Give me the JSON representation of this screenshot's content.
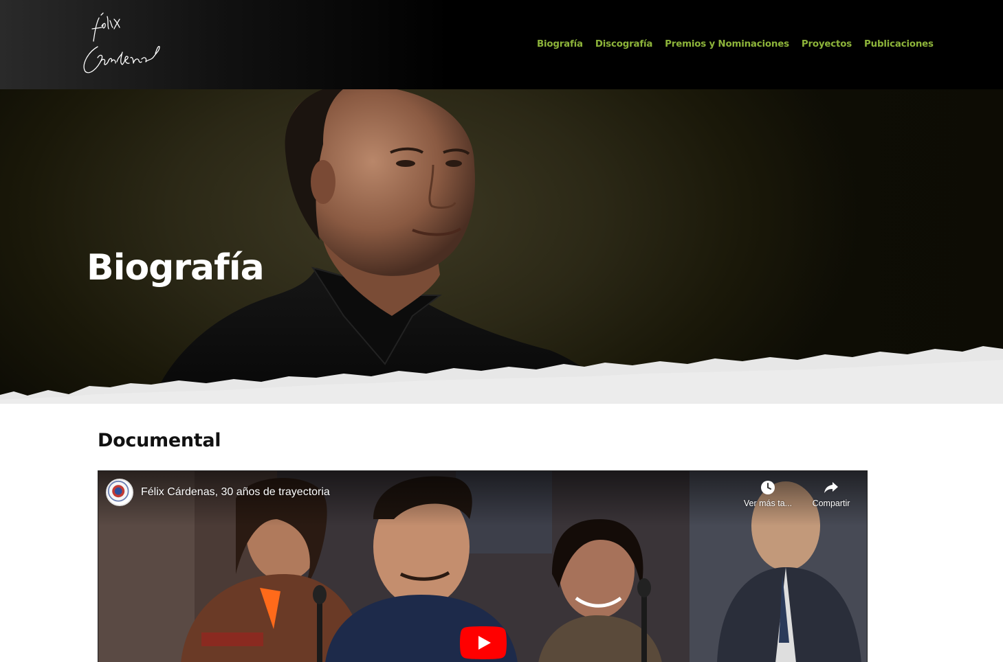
{
  "header": {
    "logo_text": "Félix Cárdenas",
    "nav": [
      {
        "label": "Biografía"
      },
      {
        "label": "Discografía"
      },
      {
        "label": "Premios y Nominaciones"
      },
      {
        "label": "Proyectos"
      },
      {
        "label": "Publicaciones"
      }
    ]
  },
  "hero": {
    "title": "Biografía"
  },
  "section": {
    "title": "Documental"
  },
  "video": {
    "title": "Félix Cárdenas, 30 años de trayectoria",
    "watch_later_label": "Ver más ta...",
    "share_label": "Compartir",
    "channel_icon": "seal-icon",
    "play_icon": "youtube-play-icon"
  },
  "colors": {
    "nav_link": "#8db43a",
    "header_bg": "#000000",
    "hero_bg": "#2b2816",
    "youtube_red": "#ff0000"
  }
}
